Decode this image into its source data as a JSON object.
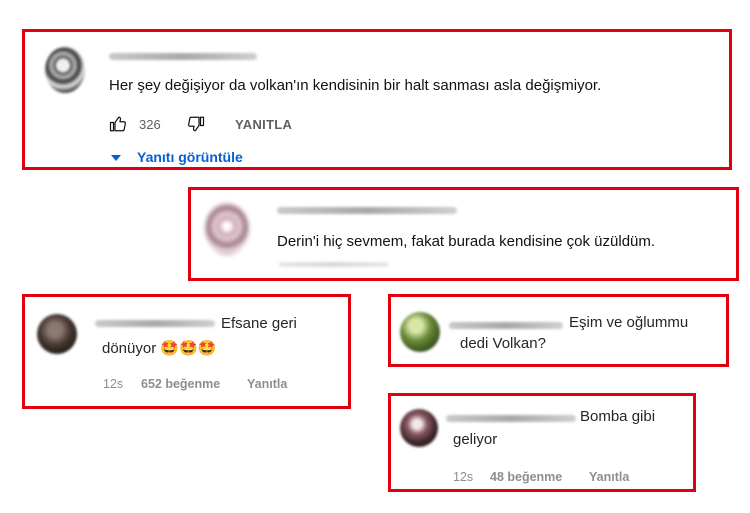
{
  "yt_comment": {
    "text": "Her şey değişiyor da volkan'ın kendisinin bir halt sanması asla değişmiyor.",
    "like_count": "326",
    "reply_label": "YANITLA",
    "view_replies_label": "Yanıtı görüntüle",
    "accent_color": "#065fd4"
  },
  "yt_comment_2": {
    "text": "Derin'i hiç sevmem, fakat burada kendisine çok üzüldüm."
  },
  "ig_comment_1": {
    "text_line1": "Efsane geri",
    "text_line2": "dönüyor",
    "emojis": [
      "🤩",
      "🤩",
      "🤩"
    ],
    "time": "12s",
    "likes": "652 beğenme",
    "reply_label": "Yanıtla"
  },
  "ig_comment_2": {
    "text_line1": "Eşim ve oğlummu",
    "text_line2": "dedi Volkan?"
  },
  "ig_comment_3": {
    "text_line1": "Bomba gibi",
    "text_line2": "geliyor",
    "time": "12s",
    "likes": "48 beğenme",
    "reply_label": "Yanıtla"
  },
  "colors": {
    "highlight_border": "#e0000f"
  }
}
